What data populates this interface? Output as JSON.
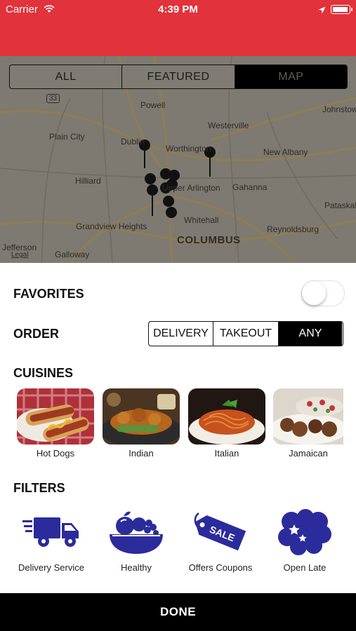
{
  "status_bar": {
    "carrier": "Carrier",
    "time": "4:39 PM"
  },
  "view_tabs": [
    {
      "label": "ALL",
      "active": false
    },
    {
      "label": "FEATURED",
      "active": false
    },
    {
      "label": "MAP",
      "active": true
    }
  ],
  "map": {
    "labels": [
      "Powell",
      "Johnstown",
      "Westerville",
      "Plain City",
      "Dublin",
      "Worthington",
      "New Albany",
      "Hilliard",
      "Upper Arlington",
      "Gahanna",
      "Pataskala",
      "Grandview Heights",
      "Whitehall",
      "Reynoldsburg",
      "COLUMBUS",
      "Jefferson",
      "Galloway"
    ],
    "legal": "Legal",
    "highway_shield": "33"
  },
  "favorites": {
    "label": "FAVORITES",
    "enabled": false
  },
  "order": {
    "label": "ORDER",
    "options": [
      {
        "label": "DELIVERY",
        "active": false
      },
      {
        "label": "TAKEOUT",
        "active": false
      },
      {
        "label": "ANY",
        "active": true
      }
    ]
  },
  "cuisines": {
    "label": "CUISINES",
    "items": [
      {
        "label": "Hot Dogs"
      },
      {
        "label": "Indian"
      },
      {
        "label": "Italian"
      },
      {
        "label": "Jamaican"
      }
    ]
  },
  "filters": {
    "label": "FILTERS",
    "items": [
      {
        "label": "Delivery Service",
        "icon": "delivery-truck-icon"
      },
      {
        "label": "Healthy",
        "icon": "fruit-bowl-icon"
      },
      {
        "label": "Offers Coupons",
        "icon": "sale-tag-icon",
        "tag_text": "SALE"
      },
      {
        "label": "Open Late",
        "icon": "moon-stars-icon"
      }
    ]
  },
  "done": {
    "label": "DONE"
  },
  "colors": {
    "header": "#e2323b",
    "filter_icon": "#2b2b9c",
    "dimmed_map": "#7e7a71"
  }
}
